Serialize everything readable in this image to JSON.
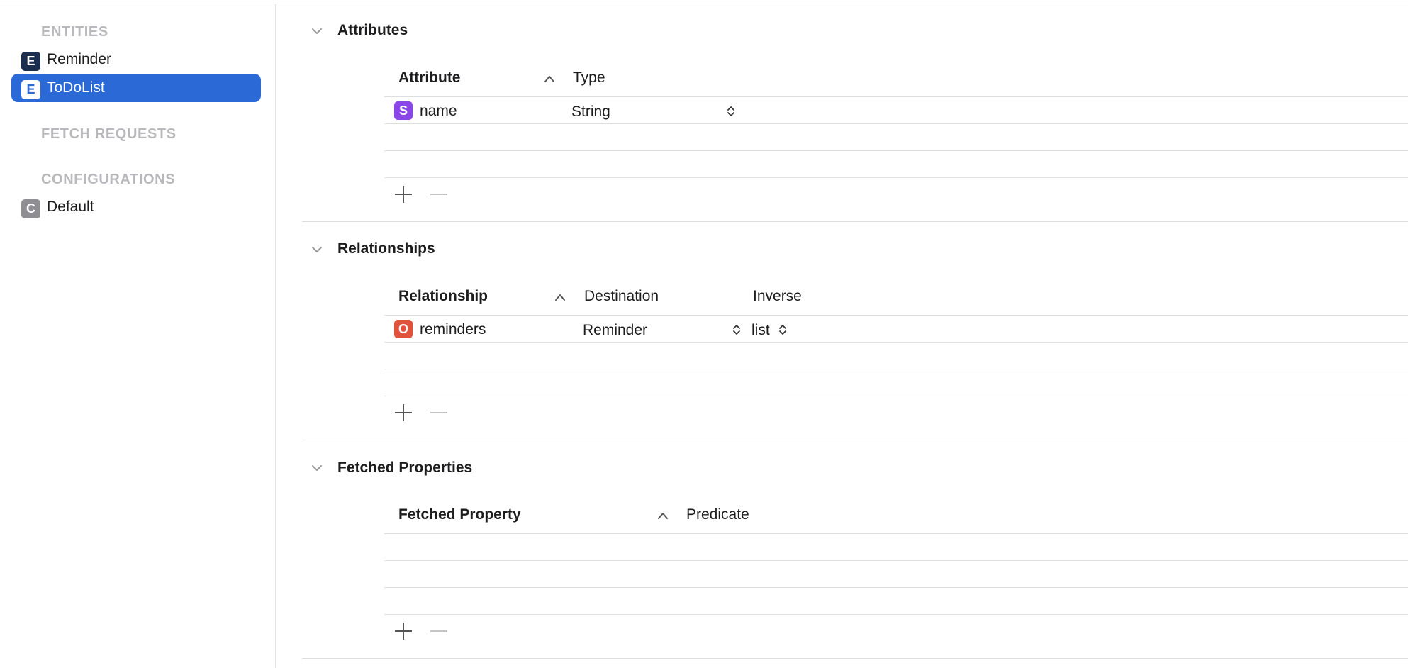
{
  "sidebar": {
    "entities_header": "ENTITIES",
    "entities": [
      {
        "badge": "E",
        "label": "Reminder",
        "selected": false
      },
      {
        "badge": "E",
        "label": "ToDoList",
        "selected": true
      }
    ],
    "fetch_requests_header": "FETCH REQUESTS",
    "configurations_header": "CONFIGURATIONS",
    "configurations": [
      {
        "badge": "C",
        "label": "Default"
      }
    ]
  },
  "attributes": {
    "title": "Attributes",
    "columns": {
      "attribute": "Attribute",
      "type": "Type"
    },
    "rows": [
      {
        "badge": "S",
        "name": "name",
        "type": "String"
      }
    ]
  },
  "relationships": {
    "title": "Relationships",
    "columns": {
      "relationship": "Relationship",
      "destination": "Destination",
      "inverse": "Inverse"
    },
    "rows": [
      {
        "badge": "O",
        "name": "reminders",
        "destination": "Reminder",
        "inverse": "list"
      }
    ]
  },
  "fetched_properties": {
    "title": "Fetched Properties",
    "columns": {
      "fetched_property": "Fetched Property",
      "predicate": "Predicate"
    },
    "rows": []
  },
  "icons": {
    "chevron": "chevron-down-icon",
    "sort": "sort-ascending-icon",
    "stepper": "up-down-stepper-icon",
    "add": "plus-icon",
    "remove": "minus-icon"
  },
  "colors": {
    "selection": "#2b6ad6",
    "entity_badge": "#1b2d4e",
    "string_badge": "#8a46e6",
    "to_one_badge": "#e0533a",
    "config_badge": "#8e8e93"
  }
}
